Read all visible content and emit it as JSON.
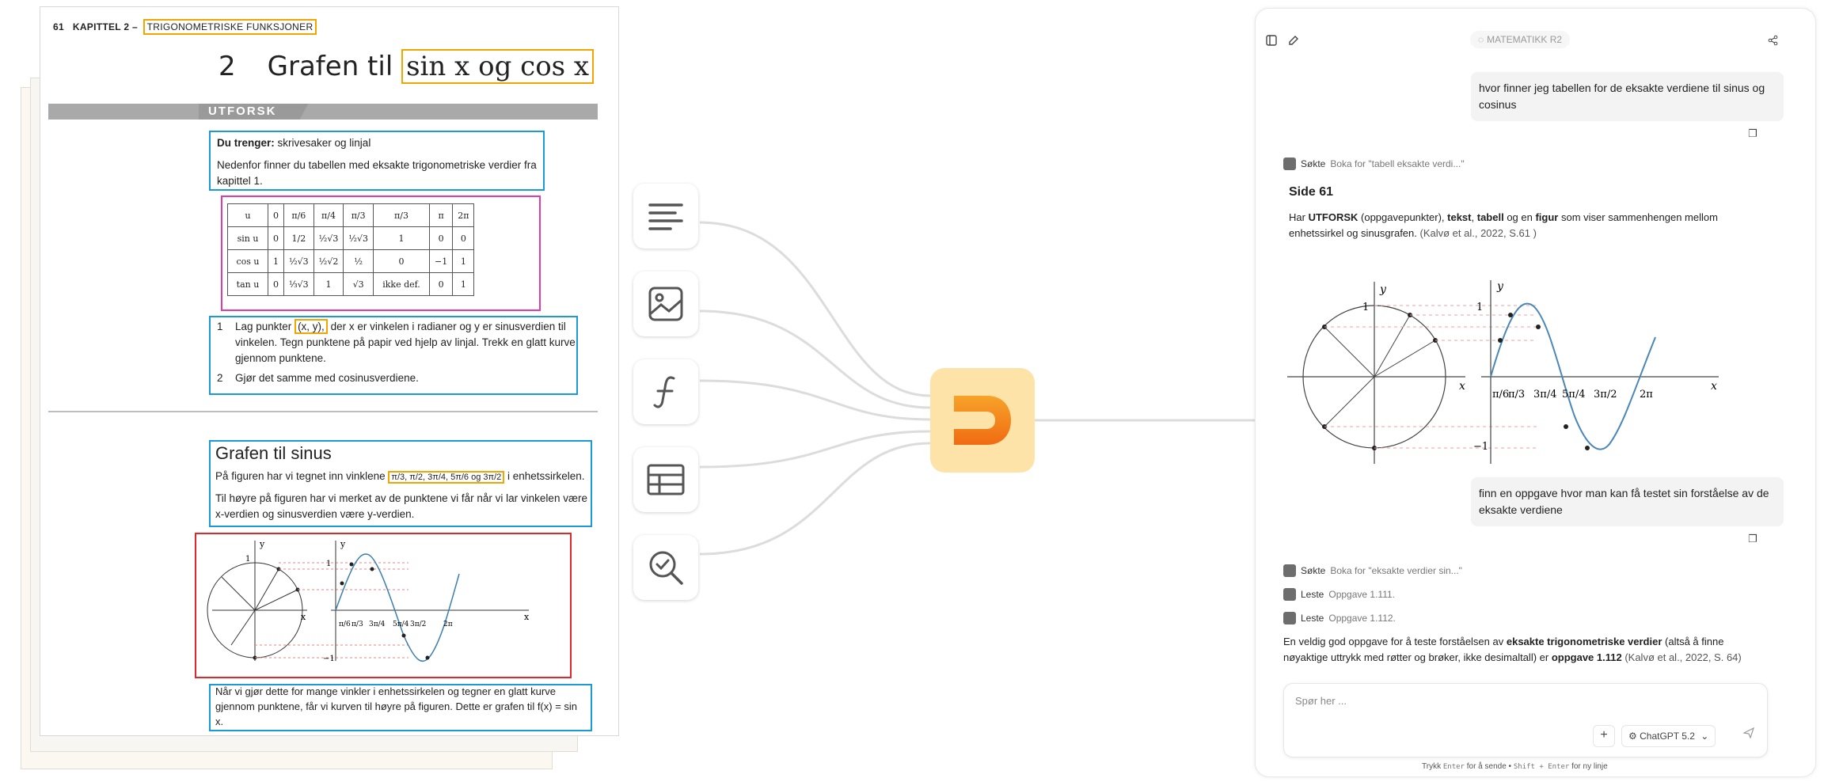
{
  "book": {
    "page_number": "61",
    "chapter_label": "KAPITTEL 2",
    "chapter_sep": "–",
    "chapter_sub": "TRIGONOMETRISKE FUNKSJONER",
    "title_number": "2",
    "title_text": "Grafen til",
    "title_highlight": "sin x og cos x",
    "utforsk": "UTFORSK",
    "need_label": "Du trenger:",
    "need_text": " skrivesaker og linjal",
    "intro": "Nedenfor finner du tabellen med eksakte trigonometriske verdier fra kapittel 1.",
    "table": {
      "rows": [
        [
          "u",
          "0",
          "π/6",
          "π/4",
          "π/3",
          "π/3",
          "π",
          "2π"
        ],
        [
          "sin u",
          "0",
          "1/2",
          "½√3",
          "½√3",
          "1",
          "0",
          "0"
        ],
        [
          "cos u",
          "1",
          "½√3",
          "½√2",
          "½",
          "0",
          "−1",
          "1"
        ],
        [
          "tan u",
          "0",
          "⅓√3",
          "1",
          "√3",
          "ikke def.",
          "0",
          "1"
        ]
      ]
    },
    "task1_num": "1",
    "task1_a": "Lag punkter ",
    "task1_point": "(x, y),",
    "task1_b": " der x er vinkelen i radianer og y er sinusverdien til vinkelen. Tegn punktene på papir ved hjelp av linjal. Trekk en glatt kurve gjennom punktene.",
    "task2_num": "2",
    "task2": "Gjør det samme med cosinusverdiene.",
    "section_title": "Grafen til sinus",
    "sec_p1a": "På figuren har vi tegnet inn vinklene ",
    "sec_p1_angles": "π/3, π/2, 3π/4, 5π/6 og 3π/2",
    "sec_p1b": " i enhetssirkelen.",
    "sec_p2": "Til høyre på figuren har vi merket av de punktene vi får når vi lar vinkelen være x-verdien og sinusverdien være y-verdien.",
    "bottom_p": "Når vi gjør dette for mange vinkler i enhetssirkelen og tegner en glatt kurve gjennom punktene, får vi kurven til høyre på figuren. Dette er grafen til f(x) = sin x."
  },
  "figure_labels": {
    "y": "y",
    "x": "x",
    "one": "1",
    "minus_one": "−1",
    "ticks": [
      "π/6",
      "π/3",
      "3π/4",
      "5π/4",
      "3π/2",
      "2π"
    ]
  },
  "chat": {
    "workspace_pill": "MATEMATIKK R2",
    "msg1": "hvor finner jeg tabellen for de eksakte verdiene til sinus og cosinus",
    "tool1_verb": "Søkte",
    "tool1_detail": "Boka for \"tabell eksakte verdi...\"",
    "ans1_heading": "Side 61",
    "ans1_a": "Har ",
    "ans1_b1": "UTFORSK",
    "ans1_c": " (oppgavepunkter), ",
    "ans1_b2": "tekst",
    "ans1_d": ", ",
    "ans1_b3": "tabell",
    "ans1_e": " og en ",
    "ans1_b4": "figur",
    "ans1_f": " som viser sammenhengen mellom enhetssirkel og sinusgrafen.",
    "ans1_cite": "(Kalvø et al., 2022, S.61 )",
    "msg2": "finn en oppgave hvor man kan få testet sin forståelse av de eksakte verdiene",
    "tool2_verb": "Søkte",
    "tool2_detail": "Boka for \"eksakte verdier sin...\"",
    "tool3_verb": "Leste",
    "tool3_detail": "Oppgave 1.111.",
    "tool4_verb": "Leste",
    "tool4_detail": "Oppgave 1.112.",
    "ans2_a": "En veldig god oppgave for å teste forståelsen av ",
    "ans2_b": "eksakte trigonometriske verdier",
    "ans2_c": " (altså å finne nøyaktige uttrykk med røtter og brøker, ikke desimaltall) er ",
    "ans2_d": "oppgave 1.112",
    "ans2_cite": " (Kalvø et al., 2022, S. 64)",
    "input_placeholder": "Spør her ...",
    "model": "ChatGPT 5.2",
    "hint_a": "Trykk",
    "hint_enter": "Enter",
    "hint_b": "for å sende •",
    "hint_shift": "Shift + Enter",
    "hint_c": "for ny linje"
  },
  "colors": {
    "blue_box": "#1a9ad6",
    "pink_box": "#e23aa8",
    "red_box": "#e0282c",
    "orange_box": "#f0a500",
    "hub_bg": "#fde3a7",
    "logo_orange": "#f5931e"
  },
  "icons": [
    "text-lines-icon",
    "image-icon",
    "function-icon",
    "table-icon",
    "search-check-icon",
    "app-logo-icon"
  ]
}
